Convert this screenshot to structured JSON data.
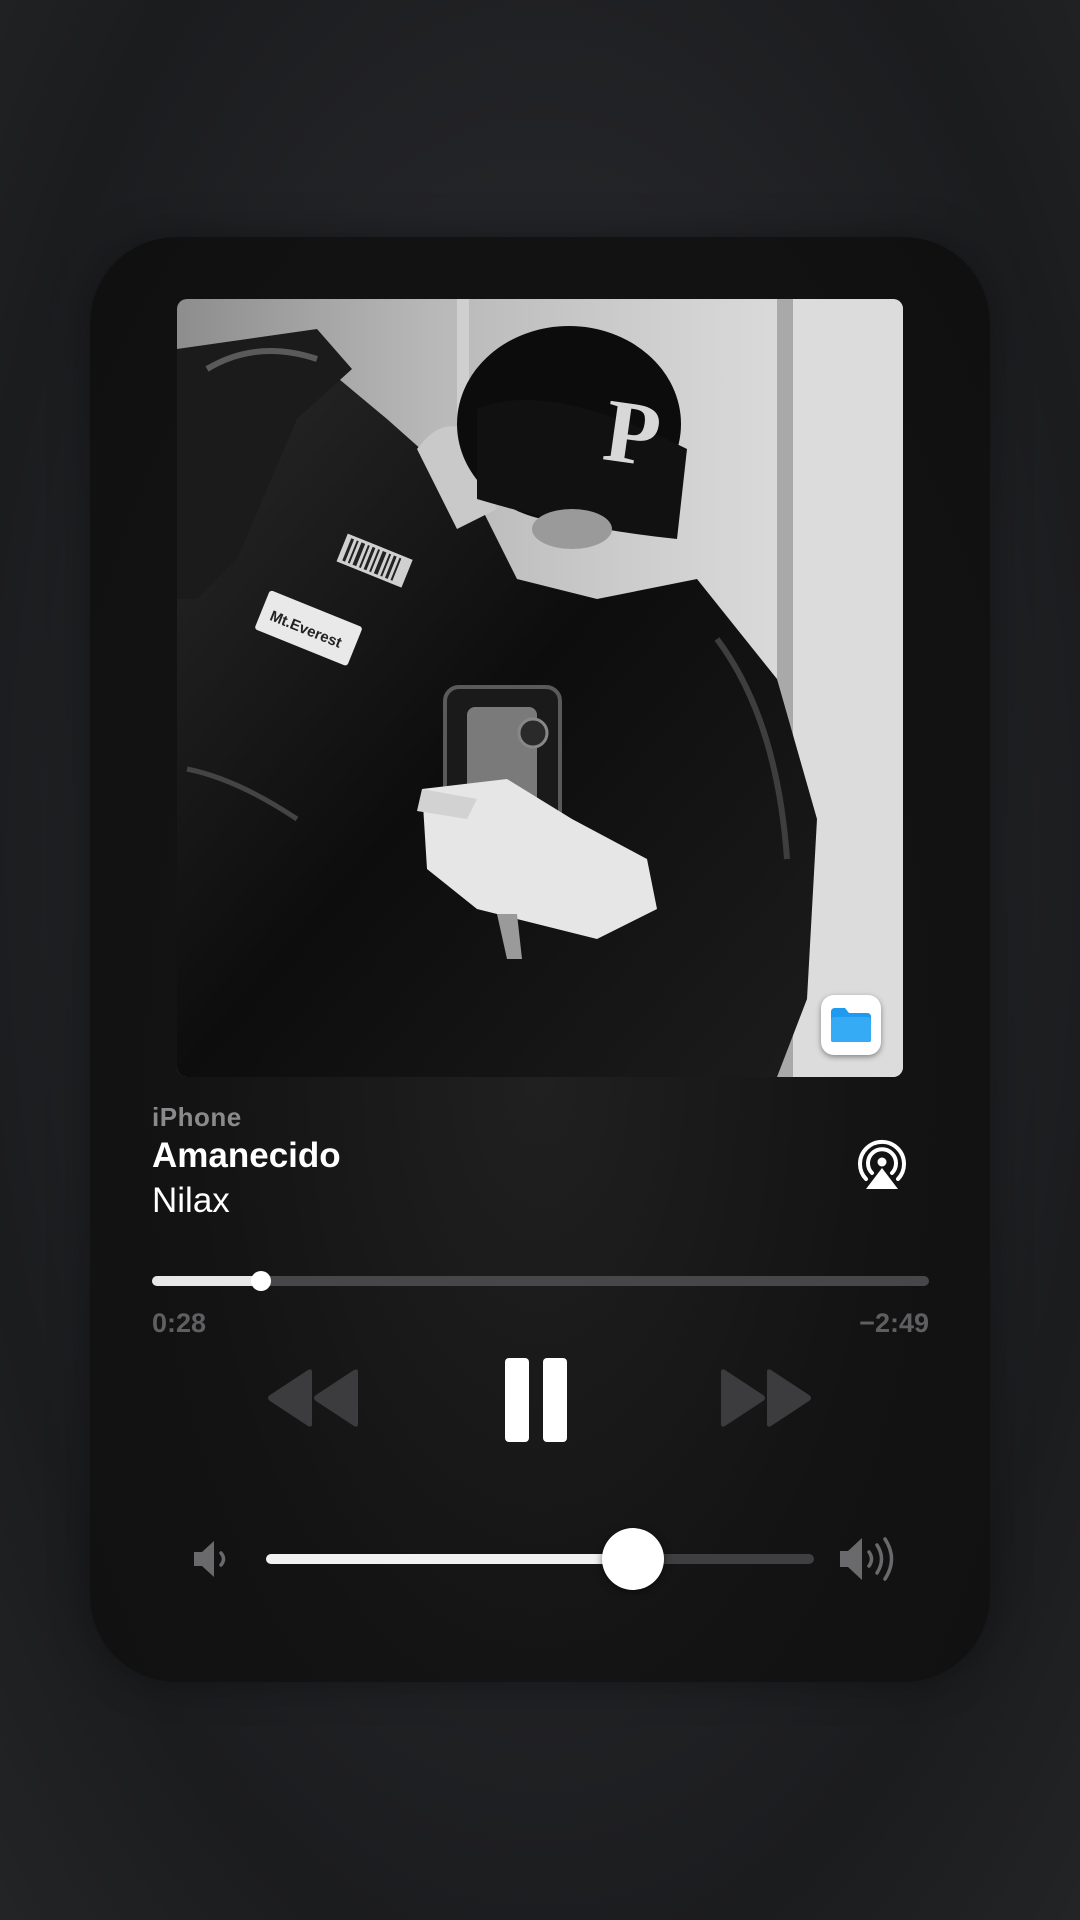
{
  "now_playing": {
    "source_device": "iPhone",
    "title": "Amanecido",
    "artist": "Nilax",
    "artwork": {
      "description_icon": "album-art-photo",
      "sticker_text": "Mt.Everest",
      "cap_letter": "P",
      "app_badge_icon": "files-app-icon"
    }
  },
  "playback": {
    "elapsed": "0:28",
    "remaining": "−2:49",
    "progress_fraction": 0.14,
    "state": "playing"
  },
  "controls": {
    "rewind_icon": "backward-icon",
    "pause_icon": "pause-icon",
    "forward_icon": "forward-icon",
    "airplay_icon": "airplay-icon"
  },
  "volume": {
    "level_fraction": 0.67,
    "low_icon": "speaker-low-icon",
    "high_icon": "speaker-high-icon"
  },
  "colors": {
    "accent": "#ffffff",
    "secondary_text": "#8a8a8c",
    "inactive_control": "#3c3c3e",
    "files_blue": "#1e9bf0"
  }
}
